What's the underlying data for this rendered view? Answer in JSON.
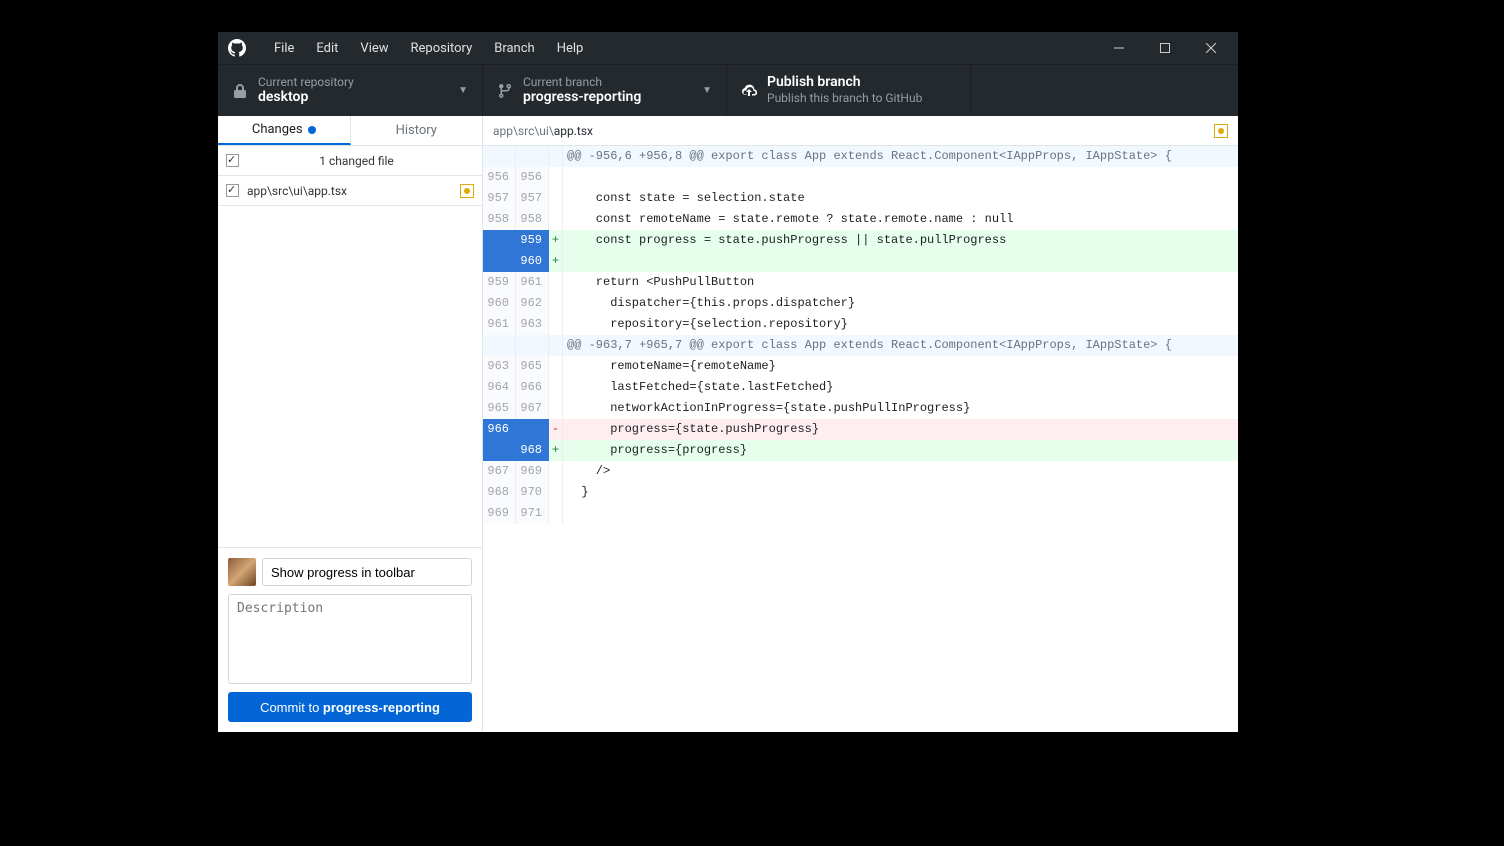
{
  "menu": [
    "File",
    "Edit",
    "View",
    "Repository",
    "Branch",
    "Help"
  ],
  "toolbar": {
    "repo_label": "Current repository",
    "repo_value": "desktop",
    "branch_label": "Current branch",
    "branch_value": "progress-reporting",
    "action_title": "Publish branch",
    "action_sub": "Publish this branch to GitHub"
  },
  "sidebar": {
    "tab_changes": "Changes",
    "tab_history": "History",
    "summary": "1 changed file",
    "file": "app\\src\\ui\\app.tsx"
  },
  "commit": {
    "summary": "Show progress in toolbar",
    "desc_placeholder": "Description",
    "button_prefix": "Commit to ",
    "button_branch": "progress-reporting"
  },
  "diff": {
    "path_prefix": "app\\src\\ui\\",
    "path_file": "app.tsx",
    "rows": [
      {
        "l": "",
        "r": "",
        "m": "",
        "t": "hunk",
        "c": "@@ -956,6 +956,8 @@ export class App extends React.Component<IAppProps, IAppState> {"
      },
      {
        "l": "956",
        "r": "956",
        "m": " ",
        "t": "ctx",
        "c": ""
      },
      {
        "l": "957",
        "r": "957",
        "m": " ",
        "t": "ctx",
        "c": "    const state = selection.state"
      },
      {
        "l": "958",
        "r": "958",
        "m": " ",
        "t": "ctx",
        "c": "    const remoteName = state.remote ? state.remote.name : null"
      },
      {
        "l": "",
        "r": "959",
        "m": "+",
        "t": "add",
        "c": "    const progress = state.pushProgress || state.pullProgress"
      },
      {
        "l": "",
        "r": "960",
        "m": "+",
        "t": "add",
        "c": ""
      },
      {
        "l": "959",
        "r": "961",
        "m": " ",
        "t": "ctx",
        "c": "    return <PushPullButton"
      },
      {
        "l": "960",
        "r": "962",
        "m": " ",
        "t": "ctx",
        "c": "      dispatcher={this.props.dispatcher}"
      },
      {
        "l": "961",
        "r": "963",
        "m": " ",
        "t": "ctx",
        "c": "      repository={selection.repository}"
      },
      {
        "l": "",
        "r": "",
        "m": "",
        "t": "hunk",
        "c": "@@ -963,7 +965,7 @@ export class App extends React.Component<IAppProps, IAppState> {"
      },
      {
        "l": "963",
        "r": "965",
        "m": " ",
        "t": "ctx",
        "c": "      remoteName={remoteName}"
      },
      {
        "l": "964",
        "r": "966",
        "m": " ",
        "t": "ctx",
        "c": "      lastFetched={state.lastFetched}"
      },
      {
        "l": "965",
        "r": "967",
        "m": " ",
        "t": "ctx",
        "c": "      networkActionInProgress={state.pushPullInProgress}"
      },
      {
        "l": "966",
        "r": "",
        "m": "-",
        "t": "del",
        "c": "      progress={state.pushProgress}"
      },
      {
        "l": "",
        "r": "968",
        "m": "+",
        "t": "add",
        "c": "      progress={progress}"
      },
      {
        "l": "967",
        "r": "969",
        "m": " ",
        "t": "ctx",
        "c": "    />"
      },
      {
        "l": "968",
        "r": "970",
        "m": " ",
        "t": "ctx",
        "c": "  }"
      },
      {
        "l": "969",
        "r": "971",
        "m": " ",
        "t": "ctx",
        "c": ""
      }
    ]
  }
}
